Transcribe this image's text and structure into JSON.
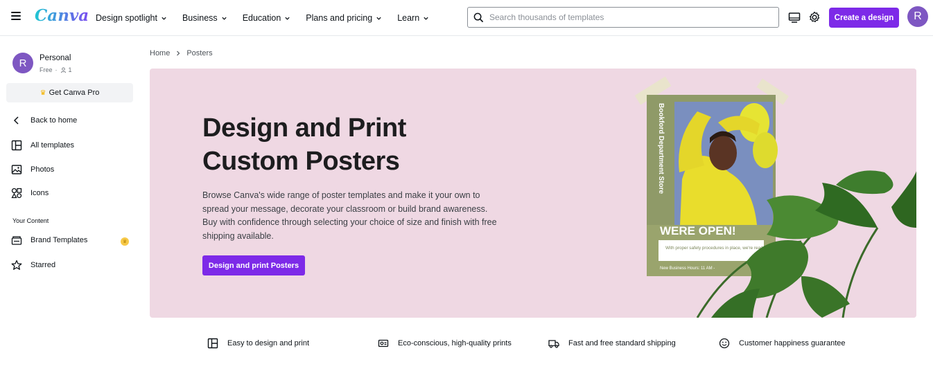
{
  "header": {
    "logo": "Canva",
    "nav": [
      {
        "label": "Design spotlight"
      },
      {
        "label": "Business"
      },
      {
        "label": "Education"
      },
      {
        "label": "Plans and pricing"
      },
      {
        "label": "Learn"
      }
    ],
    "search_placeholder": "Search thousands of templates",
    "create_label": "Create a design",
    "avatar_letter": "R"
  },
  "sidebar": {
    "account": {
      "avatar_letter": "R",
      "name": "Personal",
      "plan": "Free",
      "members": "1"
    },
    "pro_label": "Get Canva Pro",
    "items": [
      {
        "label": "Back to home"
      },
      {
        "label": "All templates"
      },
      {
        "label": "Photos"
      },
      {
        "label": "Icons"
      }
    ],
    "section_label": "Your Content",
    "content_items": [
      {
        "label": "Brand Templates"
      },
      {
        "label": "Starred"
      }
    ]
  },
  "breadcrumb": {
    "home": "Home",
    "current": "Posters"
  },
  "hero": {
    "title_line1": "Design and Print",
    "title_line2": "Custom Posters",
    "description": "Browse Canva's wide range of poster templates and make it your own to spread your message, decorate your classroom or build brand awareness. Buy with confidence through selecting your choice of size and finish with free shipping available.",
    "button_label": "Design and print Posters",
    "poster": {
      "store_name": "Bookford Department Store",
      "headline": "WERE OPEN!",
      "note": "With proper safety procedures in place, we're ready to serve you",
      "hours": "New Business Hours: 11 AM -"
    }
  },
  "features": [
    {
      "label": "Easy to design and print",
      "icon": "layout-icon"
    },
    {
      "label": "Eco-conscious, high-quality prints",
      "icon": "printer-icon"
    },
    {
      "label": "Fast and free standard shipping",
      "icon": "truck-icon"
    },
    {
      "label": "Customer happiness guarantee",
      "icon": "smile-icon"
    }
  ],
  "colors": {
    "accent": "#7d2ae8",
    "hero_bg": "#efd8e3",
    "avatar": "#7e57c2"
  }
}
